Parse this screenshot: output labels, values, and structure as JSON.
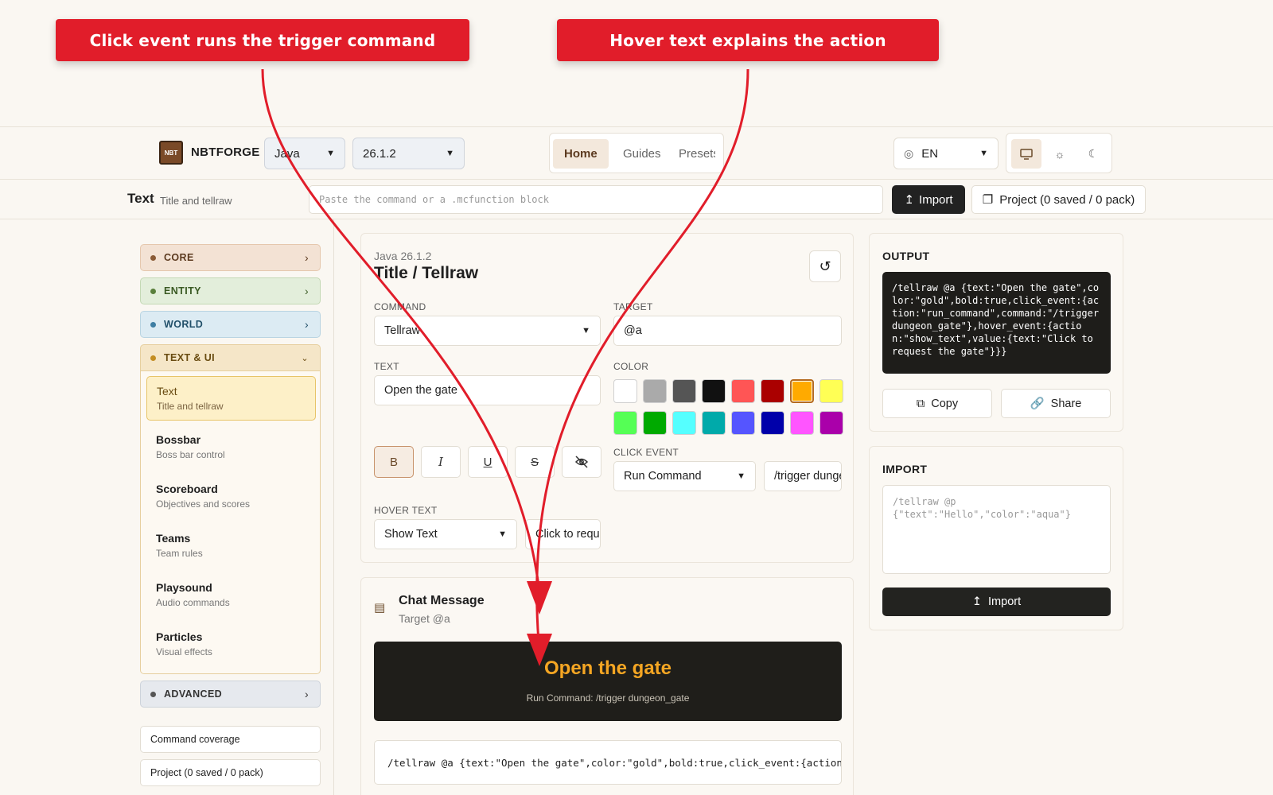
{
  "callouts": {
    "left": "Click event runs the trigger command",
    "right": "Hover text explains the action"
  },
  "header": {
    "logo_text": "NBT",
    "brand": "NBTFORGE",
    "edition": "Java",
    "version": "26.1.2",
    "nav": {
      "home": "Home",
      "guides": "Guides",
      "presets": "Presets"
    },
    "language": "EN",
    "theme_buttons": [
      "monitor-icon",
      "sun-icon",
      "moon-icon"
    ]
  },
  "toolbar": {
    "page_title": "Text",
    "page_subtitle": "Title and tellraw",
    "paste_placeholder": "Paste the command or a .mcfunction block",
    "import_label": "Import",
    "project_label": "Project (0 saved / 0 pack)"
  },
  "sidebar": {
    "categories": {
      "core": "CORE",
      "entity": "ENTITY",
      "world": "WORLD",
      "text_ui": "TEXT & UI",
      "advanced": "ADVANCED"
    },
    "items": [
      {
        "title": "Text",
        "subtitle": "Title and tellraw"
      },
      {
        "title": "Bossbar",
        "subtitle": "Boss bar control"
      },
      {
        "title": "Scoreboard",
        "subtitle": "Objectives and scores"
      },
      {
        "title": "Teams",
        "subtitle": "Team rules"
      },
      {
        "title": "Playsound",
        "subtitle": "Audio commands"
      },
      {
        "title": "Particles",
        "subtitle": "Visual effects"
      }
    ],
    "coverage_label": "Command coverage",
    "project_label": "Project (0 saved / 0 pack)"
  },
  "editor": {
    "meta": "Java 26.1.2",
    "title": "Title / Tellraw",
    "command_label": "COMMAND",
    "command_value": "Tellraw",
    "target_label": "TARGET",
    "target_value": "@a",
    "text_label": "TEXT",
    "text_value": "Open the gate",
    "color_label": "COLOR",
    "colors": [
      "#ffffff",
      "#aaaaaa",
      "#555555",
      "#111111",
      "#ff5555",
      "#aa0000",
      "#ffaa00",
      "#ffff55",
      "#55ff55",
      "#00aa00",
      "#55ffff",
      "#00aaaa",
      "#5555ff",
      "#0000aa",
      "#ff55ff",
      "#aa00aa"
    ],
    "selected_color": "#ffaa00",
    "format_buttons": [
      "bold-icon",
      "italic-icon",
      "underline-icon",
      "strikethrough-icon",
      "obfuscated-icon"
    ],
    "click_event_label": "CLICK EVENT",
    "click_event_value": "Run Command",
    "click_event_command": "/trigger dungeon_gate",
    "hover_text_label": "HOVER TEXT",
    "hover_event_value": "Show Text",
    "hover_text_value": "Click to request the gate"
  },
  "preview": {
    "title": "Chat Message",
    "subtitle": "Target @a",
    "message": "Open the gate",
    "message_color": "#f5a623",
    "action_line": "Run Command: /trigger dungeon_gate",
    "command_line": "/tellraw @a {text:\"Open the gate\",color:\"gold\",bold:true,click_event:{action:\"run_command\",command:\"/trigger dungeon_gate\"}}"
  },
  "output": {
    "label": "OUTPUT",
    "code": "/tellraw @a {text:\"Open the gate\",color:\"gold\",bold:true,click_event:{action:\"run_command\",command:\"/trigger dungeon_gate\"},hover_event:{action:\"show_text\",value:{text:\"Click to request the gate\"}}}",
    "copy_label": "Copy",
    "share_label": "Share"
  },
  "import_panel": {
    "label": "IMPORT",
    "placeholder": "/tellraw @p {\"text\":\"Hello\",\"color\":\"aqua\"}",
    "button_label": "Import"
  }
}
